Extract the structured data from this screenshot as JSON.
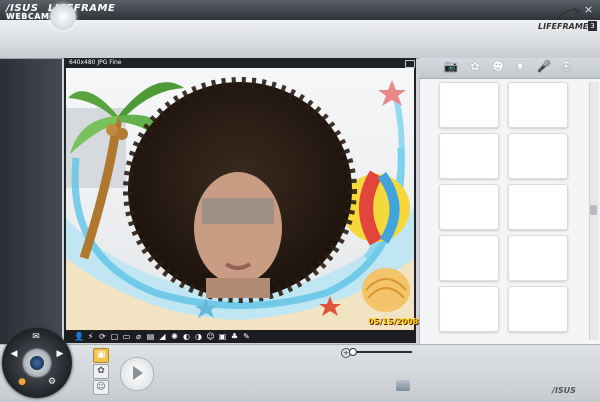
{
  "window": {
    "brand": "/ISUS",
    "title": "LIFEFRAME",
    "buttons": {
      "minimize": "–",
      "close": "×"
    }
  },
  "header": {
    "webcam_label": "WEBCAM",
    "logo_text": "LIFEFRAME",
    "logo_version": "3"
  },
  "preview": {
    "resolution_label": "640x480 JPG Fine",
    "date_stamp": "05/15/2008"
  },
  "toolbar": {
    "tools": [
      "👤",
      "⚡",
      "⟳",
      "▢",
      "▭",
      "⌀",
      "▤",
      "◢",
      "✺",
      "◐",
      "◑",
      "☺",
      "▣",
      "♣",
      "✎"
    ]
  },
  "tabs": [
    "📷",
    "✿",
    "☻",
    "♜",
    "🎤",
    "👁"
  ],
  "thumbnails": {
    "rows": 5,
    "cols": 2
  },
  "bottom": {
    "mode_icons": [
      "▣",
      "✿",
      "☺"
    ],
    "zoom_symbol": "+",
    "footer_logo": "/ISUS"
  },
  "colors": {
    "titlebar": "#3a3e44",
    "date_stamp": "#ffcc00",
    "photo_mode_active": "#f2c44f"
  }
}
